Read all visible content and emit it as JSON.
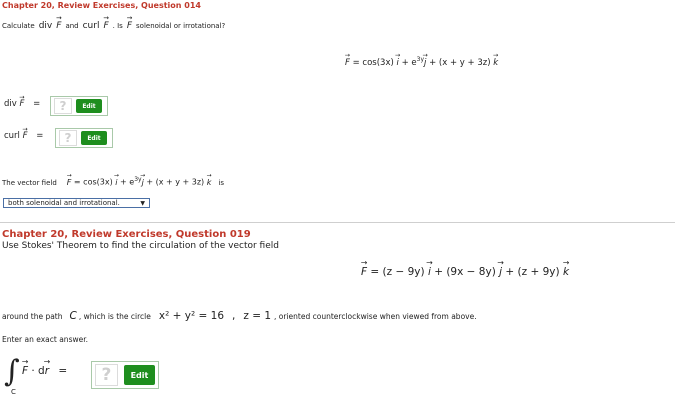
{
  "q14": {
    "title": "Chapter 20, Review Exercises, Question 014",
    "prompt_calc": "Calculate",
    "div_word": "div",
    "and_word": "and",
    "curl_word": "curl",
    "is_word": ". Is",
    "prompt_tail": "solenoidal or irrotational?",
    "field_F": "F",
    "field_rhs_1": " = cos(3x) ",
    "field_i": "i",
    "field_rhs_2": " + e",
    "field_exp": "3y",
    "field_j": "j",
    "field_rhs_3": " + (x + y + 3z) ",
    "field_k": "k",
    "div_label": "div",
    "curl_label": "curl",
    "equals": "=",
    "qmark": "?",
    "edit_label": "Edit",
    "sentence_pre": "The vector field",
    "sentence_post": "is",
    "select_value": "both solenoidal and irrotational."
  },
  "q19": {
    "title": "Chapter 20, Review Exercises, Question 019",
    "instruction": "Use Stokes' Theorem to find the circulation of the vector field",
    "field_F": "F",
    "field_rhs_1": " = (z − 9y) ",
    "field_i": "i",
    "field_rhs_2": " + (9x − 8y) ",
    "field_j": "j",
    "field_rhs_3": " + (z + 9y) ",
    "field_k": "k",
    "around_pre": "around the path",
    "path_C": "C",
    "circle_text": ", which is the circle",
    "circle_eq": "x² + y² = 16",
    "comma": ",",
    "plane_eq": "z = 1",
    "oriented_text": ", oriented counterclockwise when viewed from above.",
    "exact_answer": "Enter an exact answer.",
    "integral_sym": "∫",
    "integral_sub": "C",
    "dot_dr": " · d",
    "r_symbol": "r",
    "equals": "=",
    "qmark": "?",
    "edit_label": "Edit"
  },
  "colors": {
    "title_red": "#c0392b",
    "edit_green": "#1e8e1e",
    "select_border": "#4a6fa5"
  }
}
